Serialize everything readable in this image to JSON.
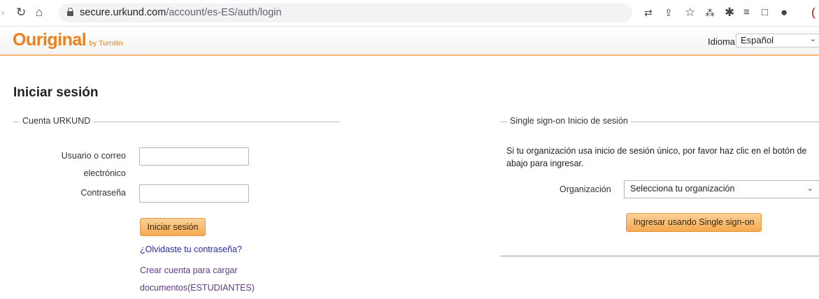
{
  "browser": {
    "url_domain": "secure.urkund.com",
    "url_path": "/account/es-ES/auth/login"
  },
  "header": {
    "logo": "Ouriginal",
    "logo_sub": "by Turnitin",
    "language_label": "Idioma",
    "language_value": "Español"
  },
  "page": {
    "title": "Iniciar sesión"
  },
  "urkund": {
    "legend": "Cuenta URKUND",
    "username_label_1": "Usuario o correo",
    "username_label_2": "electrónico",
    "password_label": "Contraseña",
    "login_button": "Iniciar sesión",
    "forgot_link": "¿Olvidaste tu contraseña?",
    "create_line1": "Crear cuenta para cargar",
    "create_line2": "documentos(ESTUDIANTES)"
  },
  "sso": {
    "legend": "Single sign-on Inicio de sesión",
    "description": "Si tu organización usa inicio de sesión único, por favor haz clic en el botón de abajo para ingresar.",
    "org_label": "Organización",
    "org_select_value": "Selecciona tu organización",
    "sso_button": "Ingresar usando Single sign-on"
  }
}
